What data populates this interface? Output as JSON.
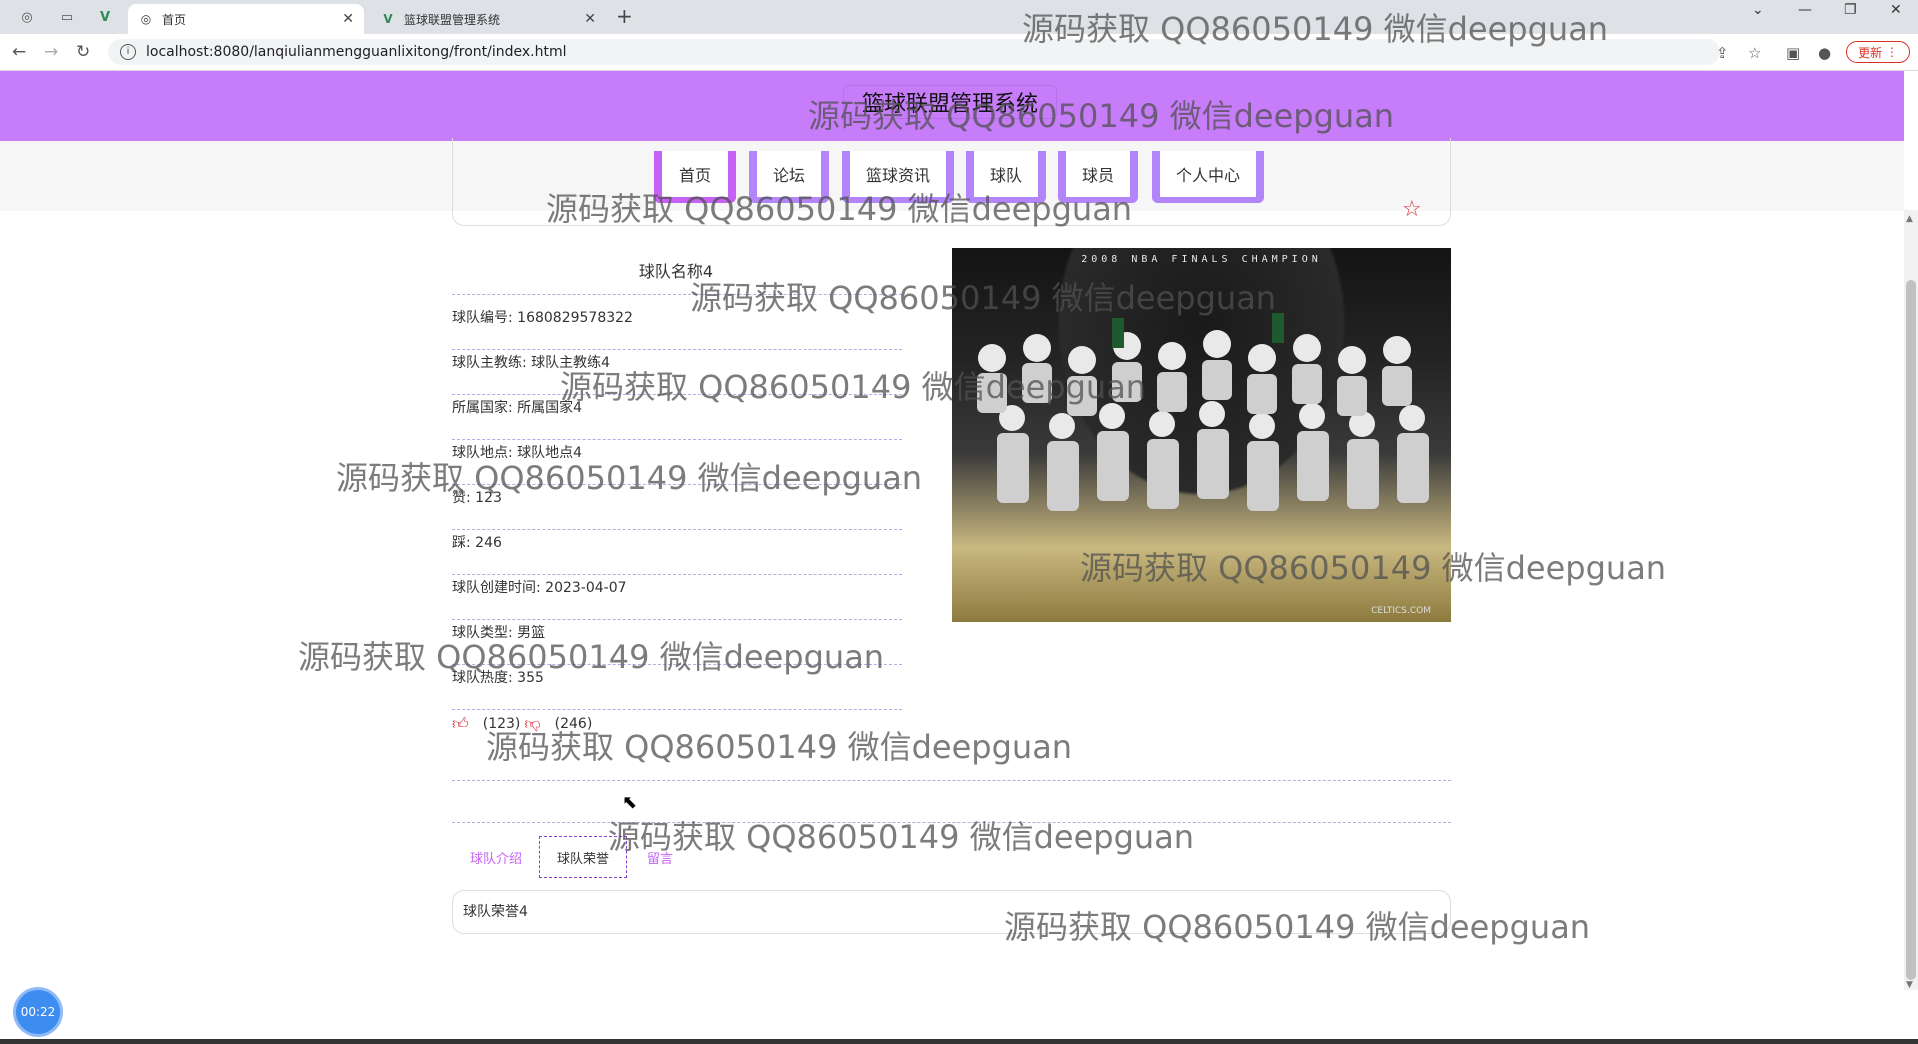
{
  "browser": {
    "tabs": [
      {
        "title": "首页",
        "active": true
      },
      {
        "title": "篮球联盟管理系统",
        "active": false
      }
    ],
    "url": "localhost:8080/lanqiulianmengguanlixitong/front/index.html",
    "update_label": "更新"
  },
  "site": {
    "title": "篮球联盟管理系统",
    "nav": [
      "首页",
      "论坛",
      "篮球资讯",
      "球队",
      "球员",
      "个人中心"
    ]
  },
  "team": {
    "name": "球队名称4",
    "rows": [
      "球队编号: 1680829578322",
      "球队主教练: 球队主教练4",
      "所属国家: 所属国家4",
      "球队地点: 球队地点4",
      "赞: 123",
      "踩: 246",
      "球队创建时间: 2023-04-07",
      "球队类型: 男篮",
      "球队热度: 355"
    ],
    "thumbs_up": "(123)",
    "thumbs_down": "(246)",
    "photo_banner": "2008 NBA FINALS CHAMPION",
    "photo_credit": "CELTICS.COM"
  },
  "content_tabs": [
    "球队介绍",
    "球队荣誉",
    "留言"
  ],
  "active_content": "球队荣誉4",
  "timer": "00:22",
  "watermark": "源码获取 QQ86050149 微信deepguan"
}
